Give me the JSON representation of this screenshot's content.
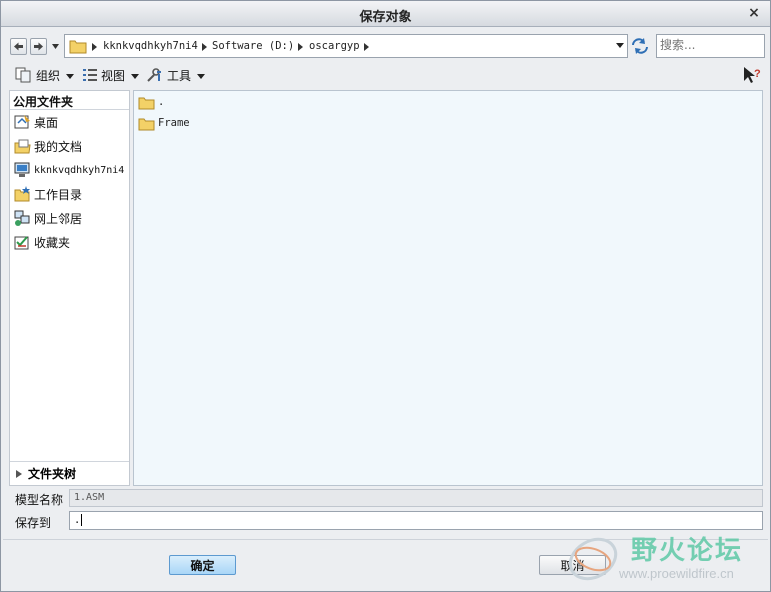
{
  "window": {
    "title": "保存对象",
    "close_glyph": "×"
  },
  "address": {
    "breadcrumbs": [
      "kknkvqdhkyh7ni4",
      "Software (D:)",
      "oscargyp"
    ]
  },
  "search": {
    "placeholder": "搜索..."
  },
  "toolbar": {
    "organize_label": "组织",
    "view_label": "视图",
    "tools_label": "工具"
  },
  "sidebar": {
    "header": "公用文件夹",
    "items": [
      {
        "label": "桌面",
        "icon": "desktop-icon"
      },
      {
        "label": "我的文档",
        "icon": "my-documents-icon"
      },
      {
        "label": "kknkvqdhkyh7ni4",
        "icon": "computer-icon"
      },
      {
        "label": "工作目录",
        "icon": "working-directory-icon"
      },
      {
        "label": "网上邻居",
        "icon": "network-icon"
      },
      {
        "label": "收藏夹",
        "icon": "favorites-icon"
      }
    ],
    "folder_tree_label": "文件夹树"
  },
  "file_list": {
    "items": [
      {
        "name": ".",
        "icon": "folder-icon"
      },
      {
        "name": "Frame",
        "icon": "folder-icon"
      }
    ]
  },
  "form": {
    "model_name_label": "模型名称",
    "model_name_value": "1.ASM",
    "save_to_label": "保存到",
    "save_to_value": "."
  },
  "buttons": {
    "ok_label": "确定",
    "cancel_label": "取消"
  },
  "watermark": {
    "title": "野火论坛",
    "url": "www.proewildfire.cn"
  },
  "colors": {
    "accent_button": "#a9d6f7",
    "file_list_bg": "#f1f8fc",
    "folder_yellow": "#f3d167",
    "watermark_green": "#5fc9a6"
  }
}
